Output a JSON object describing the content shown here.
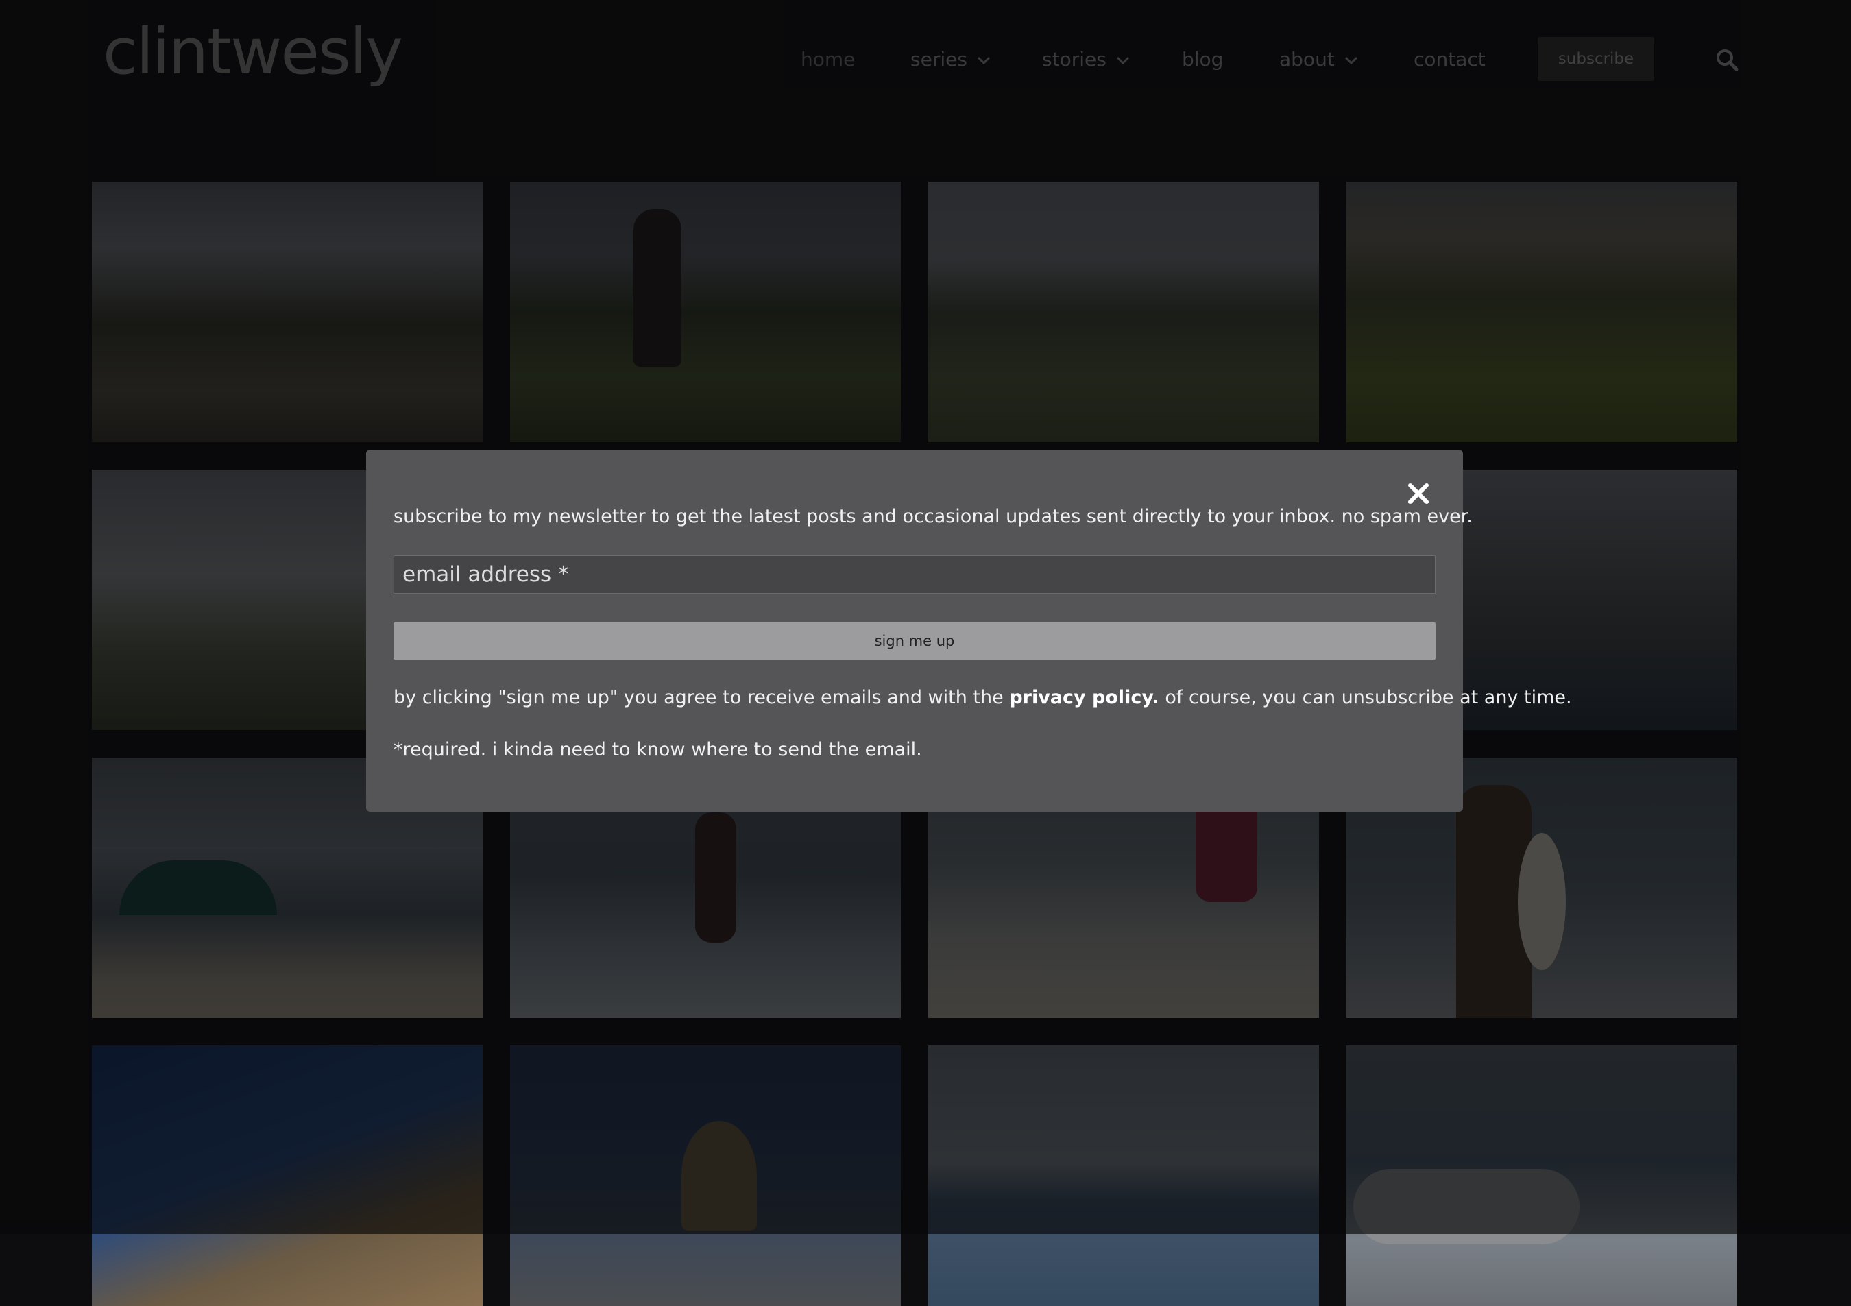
{
  "header": {
    "logo": "clintwesly",
    "nav": [
      {
        "label": "home",
        "dropdown": false
      },
      {
        "label": "series",
        "dropdown": true
      },
      {
        "label": "stories",
        "dropdown": true
      },
      {
        "label": "blog",
        "dropdown": false
      },
      {
        "label": "about",
        "dropdown": true
      },
      {
        "label": "contact",
        "dropdown": false
      }
    ],
    "subscribe_label": "subscribe"
  },
  "gallery": {
    "tiles": [
      {
        "name": "mountain-ridge-rocks"
      },
      {
        "name": "hiker-in-meadow"
      },
      {
        "name": "mountain-valley-trail"
      },
      {
        "name": "green-hillside-trail"
      },
      {
        "name": "tent-in-field"
      },
      {
        "name": "mountain-meadow"
      },
      {
        "name": "alpine-lake"
      },
      {
        "name": "jagged-peaks-lake"
      },
      {
        "name": "beach-umbrella-chairs"
      },
      {
        "name": "skimboarder-waves"
      },
      {
        "name": "skimboarder-beach"
      },
      {
        "name": "man-with-skimboard"
      },
      {
        "name": "boat-deck-ocean"
      },
      {
        "name": "sailor-at-helm"
      },
      {
        "name": "distant-sailboat"
      },
      {
        "name": "inflatable-dinghy"
      }
    ]
  },
  "modal": {
    "intro": "subscribe to my newsletter to get the latest posts and occasional updates sent directly to your inbox. no spam ever.",
    "email_placeholder": "email address *",
    "email_value": "",
    "button_label": "sign me up",
    "consent_before": "by clicking \"sign me up\" you agree to receive emails and with the ",
    "consent_link": "privacy policy.",
    "consent_after": " of course, you can unsubscribe at any time.",
    "required_note": "*required. i kinda need to know where to send the email."
  }
}
